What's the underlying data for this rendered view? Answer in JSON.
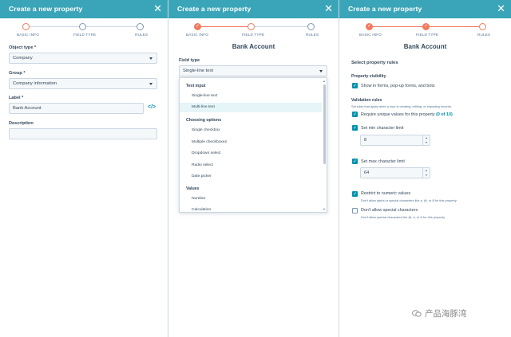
{
  "panel1": {
    "header_title": "Create a new property",
    "close": "✕",
    "steps": [
      "BASIC INFO",
      "FIELD TYPE",
      "RULES"
    ],
    "object_type_label": "Object type *",
    "object_type_value": "Company",
    "group_label": "Group *",
    "group_value": "Company information",
    "label_label": "Label *",
    "label_value": "Bank Account",
    "embed_icon": "</>",
    "description_label": "Description",
    "description_value": ""
  },
  "panel2": {
    "header_title": "Create a new property",
    "close": "✕",
    "steps": [
      "BASIC INFO",
      "FIELD TYPE",
      "RULES"
    ],
    "check": "✓",
    "page_title": "Bank Account",
    "field_type_label": "Field type",
    "field_type_value": "Single-line text",
    "dropdown": {
      "groups": [
        "Text input",
        "Choosing options",
        "Values"
      ],
      "text_input": [
        "Single-line text",
        "Multi-line text"
      ],
      "choosing_options": [
        "Single checkbox",
        "Multiple checkboxes",
        "Dropdown select",
        "Radio select",
        "Date picker"
      ],
      "values": [
        "Number",
        "Calculation"
      ]
    }
  },
  "panel3": {
    "header_title": "Create a new property",
    "close": "✕",
    "steps": [
      "BASIC INFO",
      "FIELD TYPE",
      "RULES"
    ],
    "check": "✓",
    "page_title": "Bank Account",
    "section_title": "Select property rules",
    "visibility_title": "Property visibility",
    "visibility_option": "Show in forms, pop-up forms, and bots",
    "validation_title": "Validation rules",
    "validation_sub": "Set rules that apply when a user is creating, editing, or importing records.",
    "unique_text": "Require unique values for this property",
    "unique_count": "(0 of 10)",
    "min_label": "Set min character limit",
    "min_value": "8",
    "max_label": "Set max character limit",
    "max_value": "64",
    "numeric_label": "Restrict to numeric values",
    "numeric_sub": "Don't allow alpha or special characters like a, @, or $ for this property",
    "special_label": "Don't allow special characters",
    "special_sub": "Don't allow special characters like @, #, or & for this property"
  },
  "watermark": "产品海豚湾",
  "colors": {
    "header": "#3aa5b8",
    "accent": "#0091ae",
    "step_active": "#f2795d",
    "text": "#33475b"
  }
}
